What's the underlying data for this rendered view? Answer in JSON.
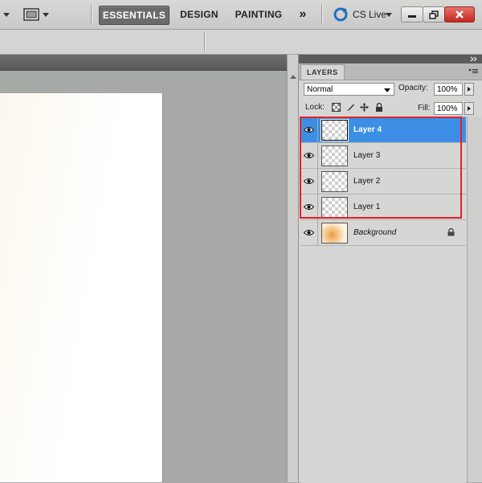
{
  "appbar": {
    "workspaces": [
      {
        "label": "ESSENTIALS",
        "active": true
      },
      {
        "label": "DESIGN",
        "active": false
      },
      {
        "label": "PAINTING",
        "active": false
      }
    ],
    "more_symbol": "»",
    "cslive_label": "CS Live",
    "colors": {
      "active_workspace": "#6b6c6a",
      "close_button": "#c5281f"
    }
  },
  "layers_panel": {
    "tab_label": "LAYERS",
    "blend_mode": "Normal",
    "opacity_label": "Opacity:",
    "opacity_value": "100%",
    "lock_label": "Lock:",
    "fill_label": "Fill:",
    "fill_value": "100%",
    "layers": [
      {
        "name": "Layer 4",
        "selected": true,
        "visible": true
      },
      {
        "name": "Layer 3",
        "selected": false,
        "visible": true
      },
      {
        "name": "Layer 2",
        "selected": false,
        "visible": true
      },
      {
        "name": "Layer 1",
        "selected": false,
        "visible": true
      },
      {
        "name": "Background",
        "selected": false,
        "visible": true,
        "locked": true
      }
    ],
    "colors": {
      "selection": "#3d8fe6",
      "highlight_outline": "#e2202a"
    }
  }
}
